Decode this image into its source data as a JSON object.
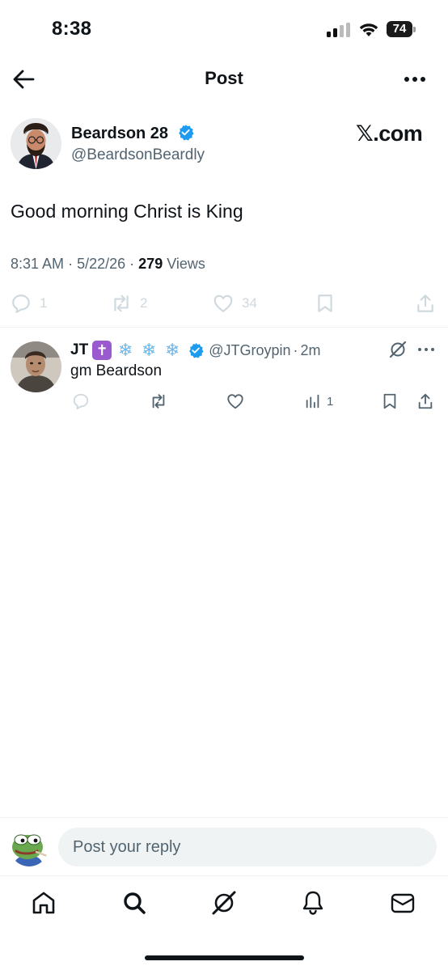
{
  "status_bar": {
    "time": "8:38",
    "battery": "74"
  },
  "header": {
    "title": "Post",
    "back_icon": "arrow-left-icon",
    "more_icon": "ellipsis-icon"
  },
  "post": {
    "author_name": "Beardson 28",
    "author_handle": "@BeardsonBeardly",
    "verified": true,
    "watermark": "𝕏.com",
    "text": "Good morning Christ is King",
    "time": "8:31 AM",
    "date": "5/22/26",
    "views_count": "279",
    "views_label": "Views",
    "separator": "·",
    "actions": {
      "replies": "1",
      "reposts": "2",
      "likes": "34"
    }
  },
  "reply": {
    "name": "JT",
    "emoji_cross": "✝",
    "emoji_snow": "❄",
    "handle": "@JTGroypin",
    "separator": "·",
    "age": "2m",
    "text": "gm Beardson",
    "views": "1"
  },
  "composer": {
    "placeholder": "Post your reply"
  },
  "colors": {
    "verified": "#1d9bf0",
    "muted": "#536471",
    "text": "#0f1419",
    "faded_icon": "#cfd9de"
  },
  "nav": {
    "items": [
      "home-icon",
      "search-icon",
      "grok-icon",
      "notifications-icon",
      "messages-icon"
    ]
  }
}
